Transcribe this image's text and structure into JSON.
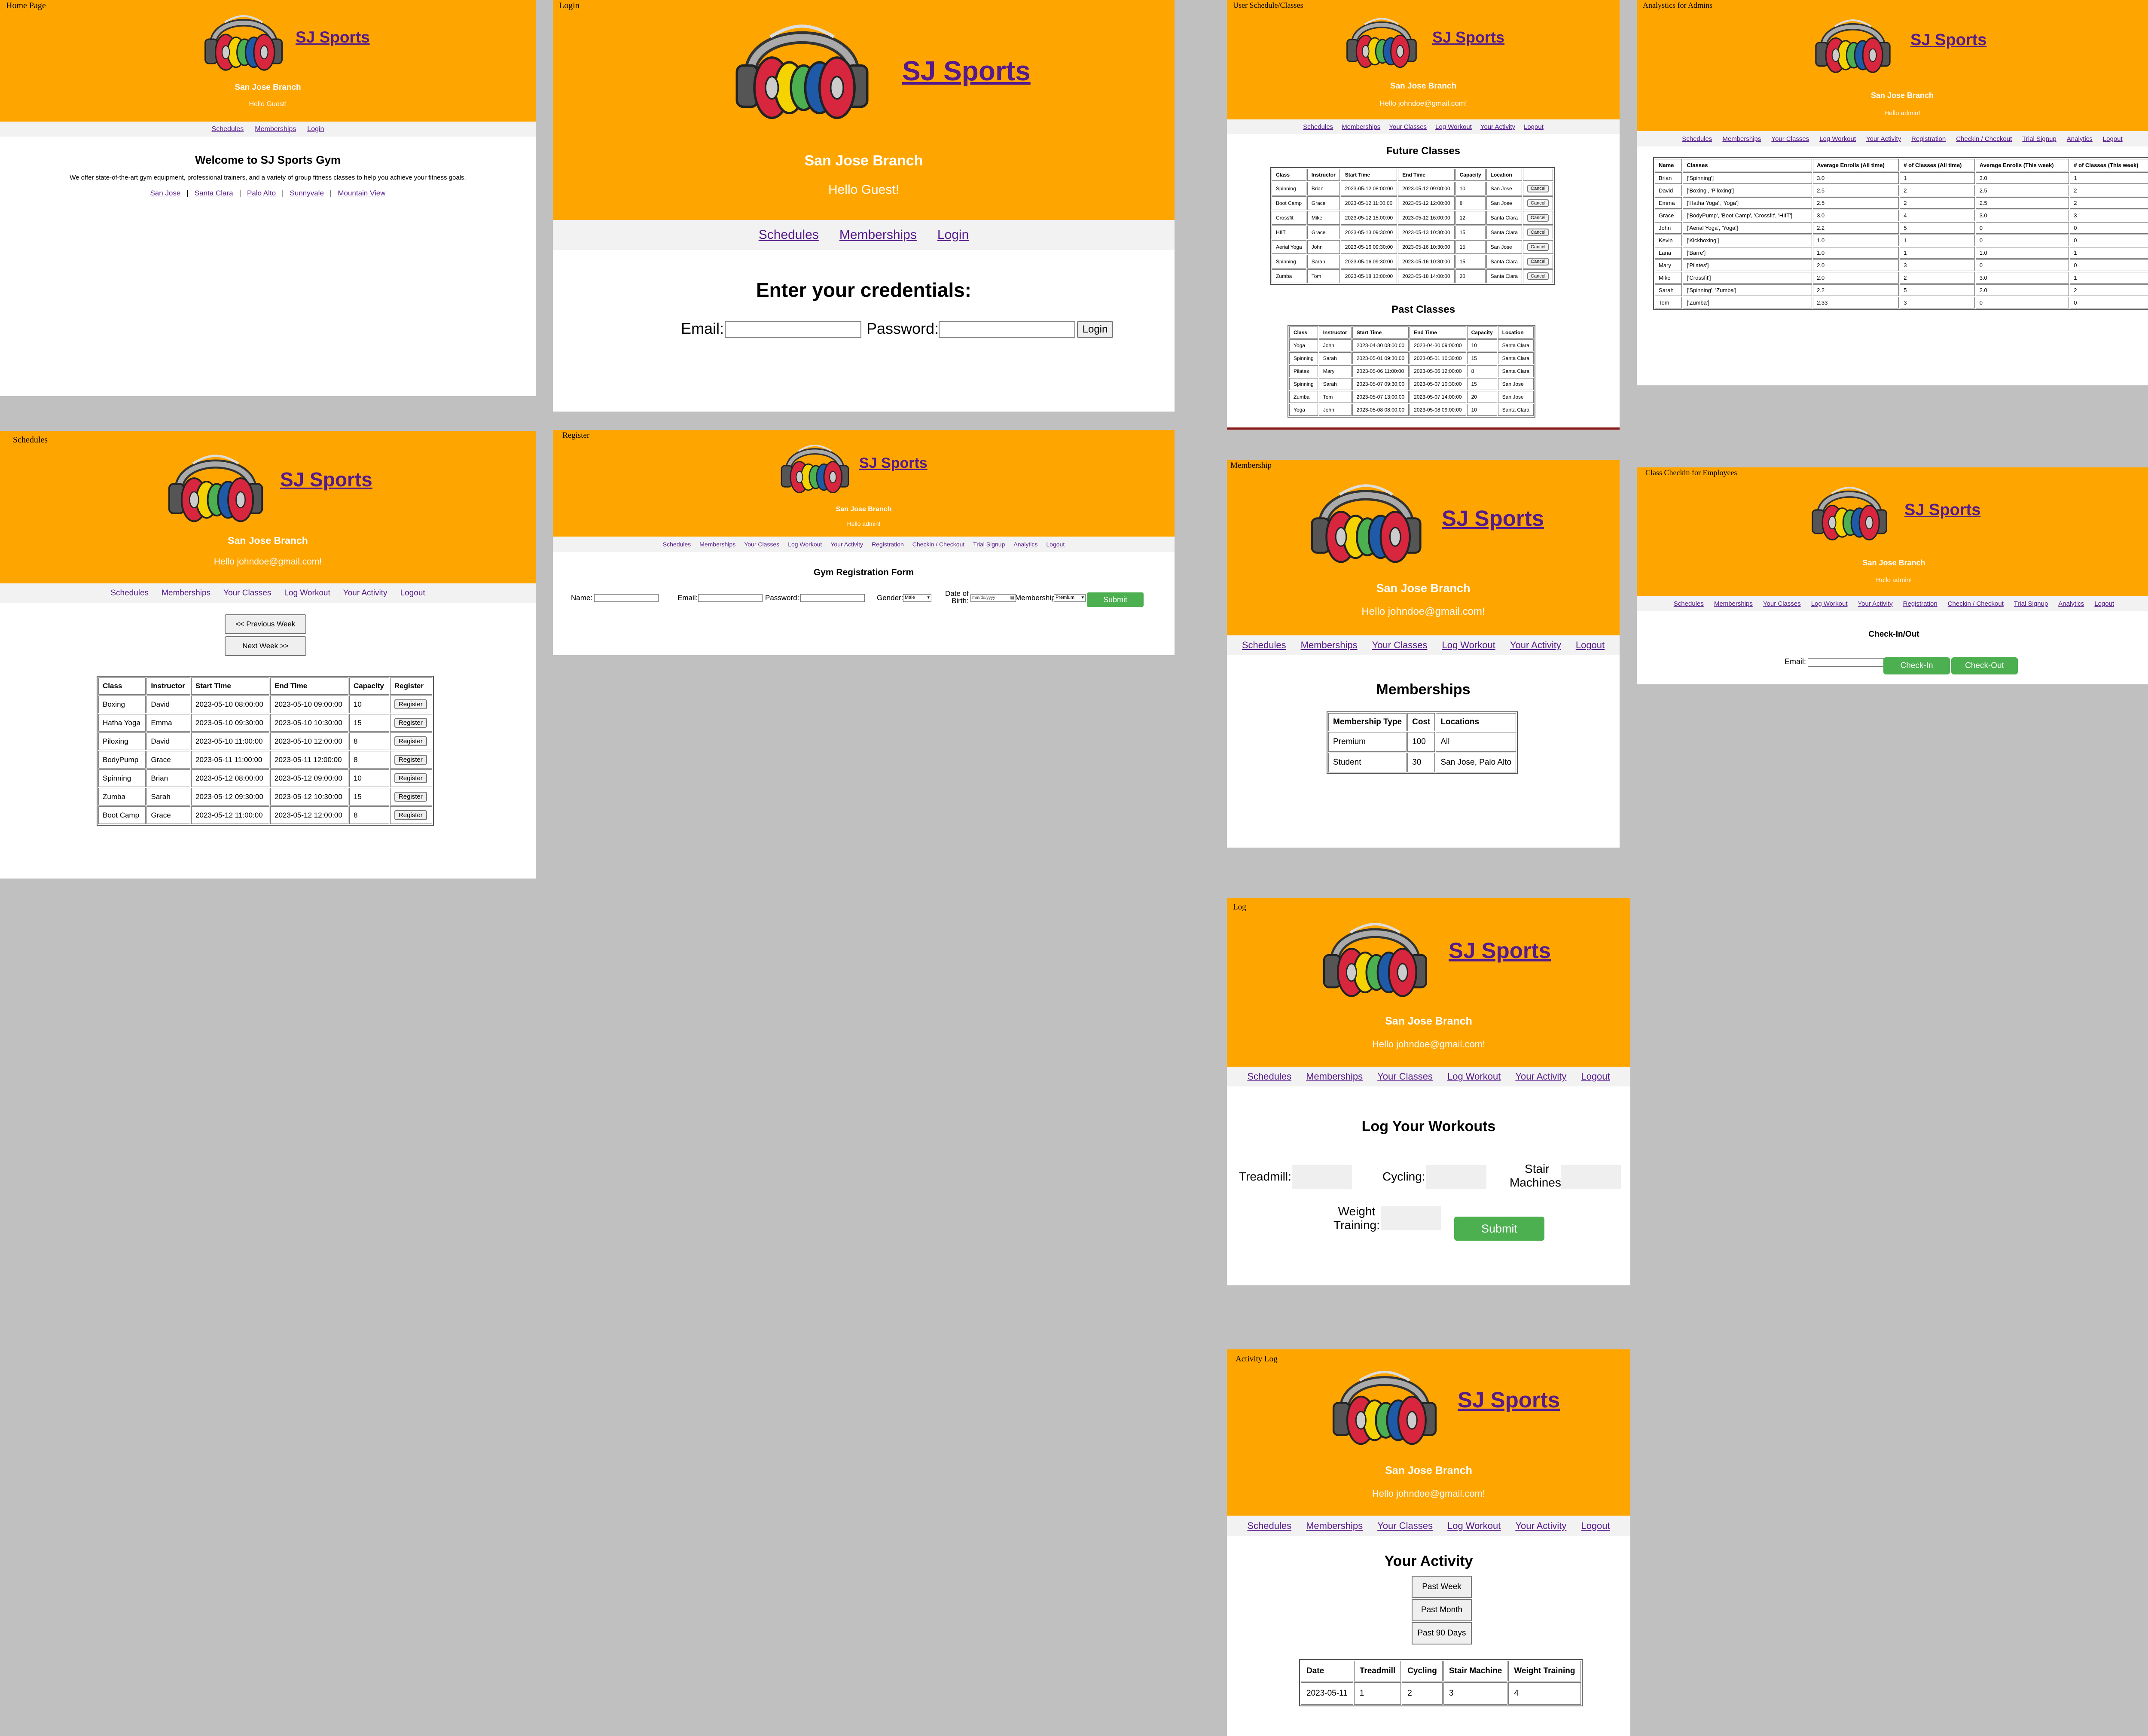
{
  "brand": "SJ Sports",
  "branch": "San Jose Branch",
  "nav": {
    "schedules": "Schedules",
    "memberships": "Memberships",
    "login": "Login",
    "your_classes": "Your Classes",
    "log_workout": "Log Workout",
    "your_activity": "Your Activity",
    "logout": "Logout",
    "registration": "Registration",
    "checkin": "Checkin / Checkout",
    "trial": "Trial Signup",
    "analytics": "Analytics"
  },
  "greet": {
    "guest": "Hello Guest!",
    "admin": "Hello admin!",
    "john": "Hello johndoe@gmail.com!"
  },
  "colors": {
    "header": "#ffa500",
    "link": "#551a8b",
    "button_green": "#4caf50",
    "background": "#c0c0c0"
  },
  "home": {
    "title": "Home Page",
    "welcome": "Welcome to SJ Sports Gym",
    "desc": "We offer state-of-the-art gym equipment, professional trainers, and a variety of group fitness classes to help you achieve your fitness goals.",
    "locations": [
      "San Jose",
      "Santa Clara",
      "Palo Alto",
      "Sunnyvale",
      "Mountain View"
    ],
    "sep": "|"
  },
  "login": {
    "title": "Login",
    "heading": "Enter your credentials:",
    "email_label": "Email:",
    "password_label": "Password:",
    "button": "Login"
  },
  "userclasses": {
    "title": "User Schedule/Classes",
    "future_heading": "Future Classes",
    "past_heading": "Past Classes",
    "future_headers": [
      "Class",
      "Instructor",
      "Start Time",
      "End Time",
      "Capacity",
      "Location"
    ],
    "future_rows": [
      [
        "Spinning",
        "Brian",
        "2023-05-12 08:00:00",
        "2023-05-12 09:00:00",
        "10",
        "San Jose"
      ],
      [
        "Boot Camp",
        "Grace",
        "2023-05-12 11:00:00",
        "2023-05-12 12:00:00",
        "8",
        "San Jose"
      ],
      [
        "Crossfit",
        "Mike",
        "2023-05-12 15:00:00",
        "2023-05-12 16:00:00",
        "12",
        "Santa Clara"
      ],
      [
        "HIIT",
        "Grace",
        "2023-05-13 09:30:00",
        "2023-05-13 10:30:00",
        "15",
        "Santa Clara"
      ],
      [
        "Aerial Yoga",
        "John",
        "2023-05-16 09:30:00",
        "2023-05-16 10:30:00",
        "15",
        "San Jose"
      ],
      [
        "Spinning",
        "Sarah",
        "2023-05-16 09:30:00",
        "2023-05-16 10:30:00",
        "15",
        "Santa Clara"
      ],
      [
        "Zumba",
        "Tom",
        "2023-05-18 13:00:00",
        "2023-05-18 14:00:00",
        "20",
        "Santa Clara"
      ]
    ],
    "cancel_label": "Cancel",
    "past_headers": [
      "Class",
      "Instructor",
      "Start Time",
      "End Time",
      "Capacity",
      "Location"
    ],
    "past_rows": [
      [
        "Yoga",
        "John",
        "2023-04-30 08:00:00",
        "2023-04-30 09:00:00",
        "10",
        "Santa Clara"
      ],
      [
        "Spinning",
        "Sarah",
        "2023-05-01 09:30:00",
        "2023-05-01 10:30:00",
        "15",
        "Santa Clara"
      ],
      [
        "Pilates",
        "Mary",
        "2023-05-06 11:00:00",
        "2023-05-06 12:00:00",
        "8",
        "Santa Clara"
      ],
      [
        "Spinning",
        "Sarah",
        "2023-05-07 09:30:00",
        "2023-05-07 10:30:00",
        "15",
        "San Jose"
      ],
      [
        "Zumba",
        "Tom",
        "2023-05-07 13:00:00",
        "2023-05-07 14:00:00",
        "20",
        "San Jose"
      ],
      [
        "Yoga",
        "John",
        "2023-05-08 08:00:00",
        "2023-05-08 09:00:00",
        "10",
        "Santa Clara"
      ]
    ]
  },
  "analytics": {
    "title": "Analystics for Admins",
    "headers": [
      "Name",
      "Classes",
      "Average Enrolls (All time)",
      "# of Classes (All time)",
      "Average Enrolls (This week)",
      "# of Classes (This week)"
    ],
    "rows": [
      [
        "Brian",
        "['Spinning']",
        "3.0",
        "1",
        "3.0",
        "1"
      ],
      [
        "David",
        "['Boxing', 'Piloxing']",
        "2.5",
        "2",
        "2.5",
        "2"
      ],
      [
        "Emma",
        "['Hatha Yoga', 'Yoga']",
        "2.5",
        "2",
        "2.5",
        "2"
      ],
      [
        "Grace",
        "['BodyPump', 'Boot Camp', 'Crossfit', 'HIIT']",
        "3.0",
        "4",
        "3.0",
        "3"
      ],
      [
        "John",
        "['Aerial Yoga', 'Yoga']",
        "2.2",
        "5",
        "0",
        "0"
      ],
      [
        "Kevin",
        "['Kickboxing']",
        "1.0",
        "1",
        "0",
        "0"
      ],
      [
        "Lana",
        "['Barre']",
        "1.0",
        "1",
        "1.0",
        "1"
      ],
      [
        "Mary",
        "['Pilates']",
        "2.0",
        "3",
        "0",
        "0"
      ],
      [
        "Mike",
        "['Crossfit']",
        "2.0",
        "2",
        "3.0",
        "1"
      ],
      [
        "Sarah",
        "['Spinning', 'Zumba']",
        "2.2",
        "5",
        "2.0",
        "2"
      ],
      [
        "Tom",
        "['Zumba']",
        "2.33",
        "3",
        "0",
        "0"
      ]
    ]
  },
  "schedules": {
    "title": "Schedules",
    "prev": "<< Previous Week",
    "next": "Next Week >>",
    "headers": [
      "Class",
      "Instructor",
      "Start Time",
      "End Time",
      "Capacity",
      "Register"
    ],
    "rows": [
      [
        "Boxing",
        "David",
        "2023-05-10 08:00:00",
        "2023-05-10 09:00:00",
        "10"
      ],
      [
        "Hatha Yoga",
        "Emma",
        "2023-05-10 09:30:00",
        "2023-05-10 10:30:00",
        "15"
      ],
      [
        "Piloxing",
        "David",
        "2023-05-10 11:00:00",
        "2023-05-10 12:00:00",
        "8"
      ],
      [
        "BodyPump",
        "Grace",
        "2023-05-11 11:00:00",
        "2023-05-11 12:00:00",
        "8"
      ],
      [
        "Spinning",
        "Brian",
        "2023-05-12 08:00:00",
        "2023-05-12 09:00:00",
        "10"
      ],
      [
        "Zumba",
        "Sarah",
        "2023-05-12 09:30:00",
        "2023-05-12 10:30:00",
        "15"
      ],
      [
        "Boot Camp",
        "Grace",
        "2023-05-12 11:00:00",
        "2023-05-12 12:00:00",
        "8"
      ]
    ],
    "register_label": "Register"
  },
  "register": {
    "title": "Register",
    "heading": "Gym Registration Form",
    "name": "Name:",
    "email": "Email:",
    "password": "Password:",
    "gender": "Gender:",
    "gender_value": "Male",
    "dob_line1": "Date of",
    "dob_line2": "Birth:",
    "dob_placeholder": "mm/dd/yyyy",
    "membership": "Membership:",
    "membership_value": "Premium",
    "submit": "Submit"
  },
  "membership": {
    "title": "Membership",
    "heading": "Memberships",
    "headers": [
      "Membership Type",
      "Cost",
      "Locations"
    ],
    "rows": [
      [
        "Premium",
        "100",
        "All"
      ],
      [
        "Student",
        "30",
        "San Jose, Palo Alto"
      ]
    ]
  },
  "checkin": {
    "title": "Class Checkin for Employees",
    "heading": "Check-In/Out",
    "email": "Email:",
    "in": "Check-In",
    "out": "Check-Out"
  },
  "log": {
    "title": "Log",
    "heading": "Log Your Workouts",
    "treadmill": "Treadmill:",
    "cycling": "Cycling:",
    "stair1": "Stair",
    "stair2": "Machines:",
    "weight1": "Weight",
    "weight2": "Training:",
    "submit": "Submit"
  },
  "activity": {
    "title": "Activity Log",
    "heading": "Your Activity",
    "buttons": [
      "Past Week",
      "Past Month",
      "Past 90 Days"
    ],
    "headers": [
      "Date",
      "Treadmill",
      "Cycling",
      "Stair Machine",
      "Weight Training"
    ],
    "rows": [
      [
        "2023-05-11",
        "1",
        "2",
        "3",
        "4"
      ]
    ]
  }
}
